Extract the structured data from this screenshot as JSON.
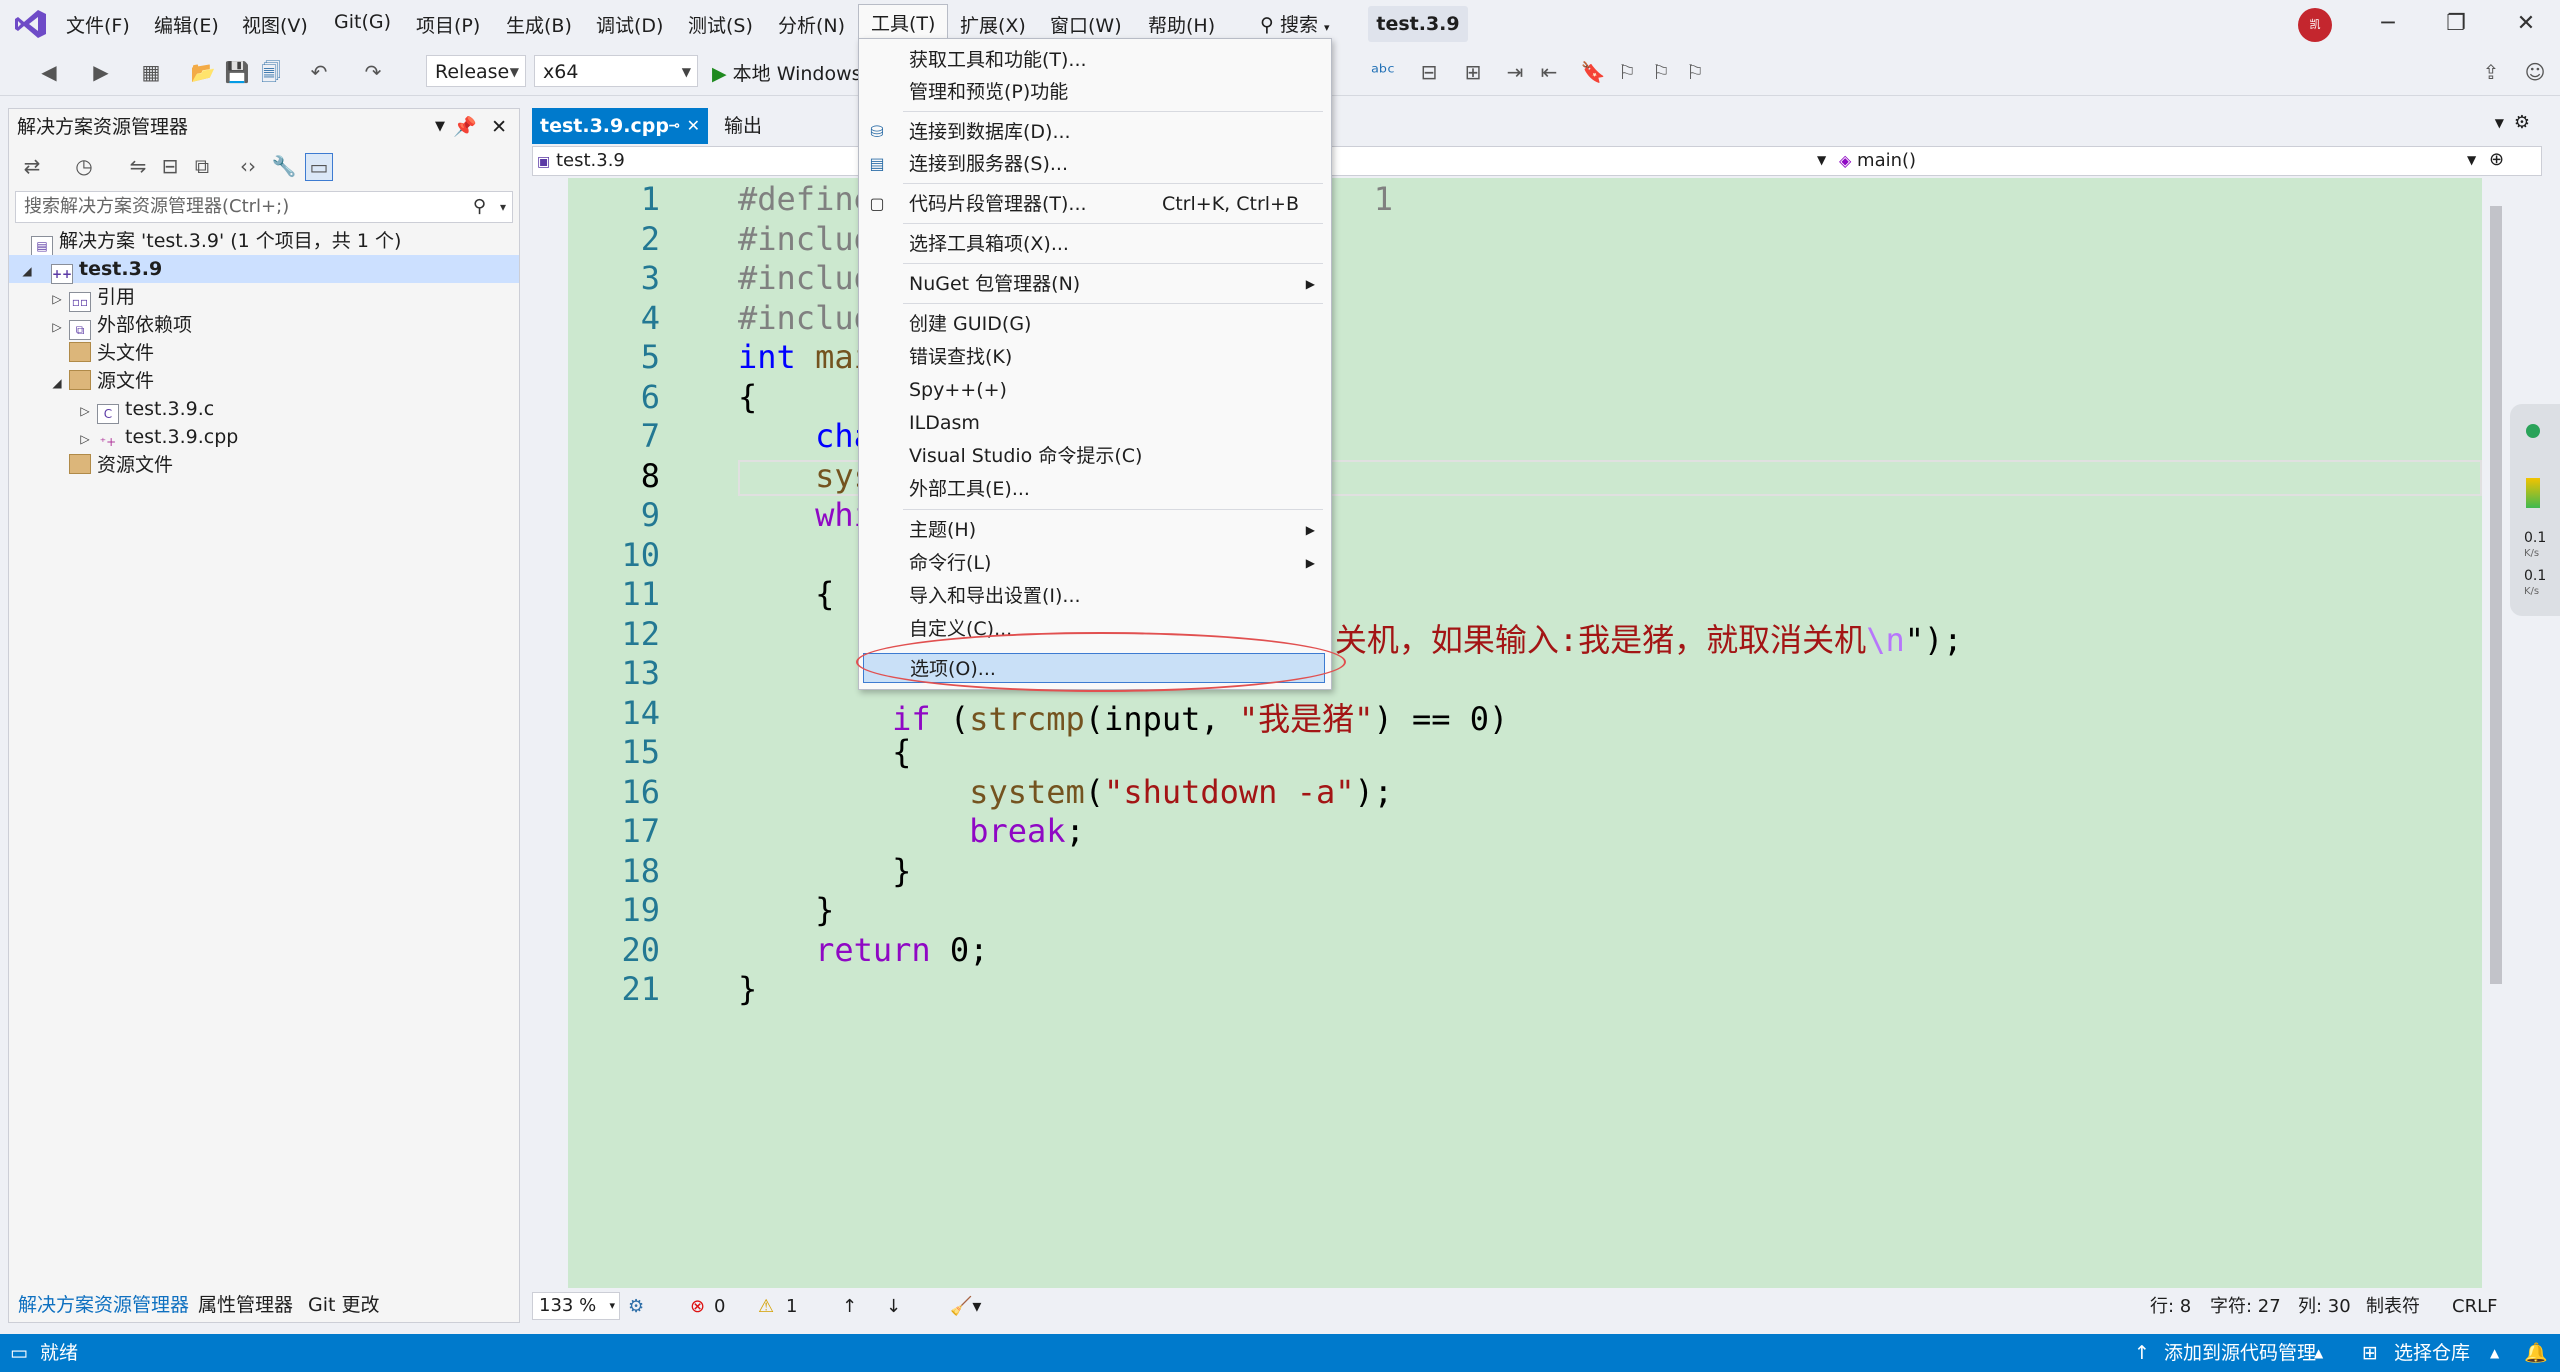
{
  "menubar": {
    "items": [
      "文件(F)",
      "编辑(E)",
      "视图(V)",
      "Git(G)",
      "项目(P)",
      "生成(B)",
      "调试(D)",
      "测试(S)",
      "分析(N)",
      "工具(T)",
      "扩展(X)",
      "窗口(W)",
      "帮助(H)"
    ],
    "search_label": "搜索",
    "title": "test.3.9",
    "avatar_text": "凯"
  },
  "toolbar": {
    "config": "Release",
    "platform": "x64",
    "run_label": "本地 Windows"
  },
  "solution_explorer": {
    "title": "解决方案资源管理器",
    "search_placeholder": "搜索解决方案资源管理器(Ctrl+;)",
    "tree": [
      {
        "label": "解决方案 'test.3.9' (1 个项目，共 1 个)",
        "indent": 0
      },
      {
        "label": "test.3.9",
        "indent": 1,
        "selected": true
      },
      {
        "label": "引用",
        "indent": 2
      },
      {
        "label": "外部依赖项",
        "indent": 2
      },
      {
        "label": "头文件",
        "indent": 2
      },
      {
        "label": "源文件",
        "indent": 2
      },
      {
        "label": "test.3.9.c",
        "indent": 3
      },
      {
        "label": "test.3.9.cpp",
        "indent": 3
      },
      {
        "label": "资源文件",
        "indent": 2
      }
    ],
    "bottom_tabs": [
      "解决方案资源管理器",
      "属性管理器",
      "Git 更改"
    ]
  },
  "editor": {
    "active_tab": "test.3.9.cpp",
    "other_tab": "输出",
    "nav_project": "test.3.9",
    "nav_function": "main()",
    "line_numbers": [
      "1",
      "2",
      "3",
      "4",
      "5",
      "6",
      "7",
      "8",
      "9",
      "10",
      "11",
      "12",
      "13",
      "14",
      "15",
      "16",
      "17",
      "18",
      "19",
      "20",
      "21"
    ]
  },
  "tools_menu": {
    "items": [
      {
        "label": "获取工具和功能(T)..."
      },
      {
        "label": "管理和预览(P)功能"
      },
      {
        "label": "连接到数据库(D)...",
        "icon": "database-icon"
      },
      {
        "label": "连接到服务器(S)...",
        "icon": "server-icon"
      },
      {
        "label": "代码片段管理器(T)...",
        "shortcut": "Ctrl+K, Ctrl+B",
        "icon": "snippet-icon"
      },
      {
        "label": "选择工具箱项(X)..."
      },
      {
        "label": "NuGet 包管理器(N)",
        "submenu": true
      },
      {
        "label": "创建 GUID(G)"
      },
      {
        "label": "错误查找(K)"
      },
      {
        "label": "Spy++(+)"
      },
      {
        "label": "ILDasm"
      },
      {
        "label": "Visual Studio 命令提示(C)"
      },
      {
        "label": "外部工具(E)..."
      },
      {
        "label": "主题(H)",
        "submenu": true
      },
      {
        "label": "命令行(L)",
        "submenu": true
      },
      {
        "label": "导入和导出设置(I)..."
      },
      {
        "label": "自定义(C)..."
      },
      {
        "label": "选项(O)...",
        "highlighted": true
      }
    ]
  },
  "editor_status": {
    "zoom": "133 %",
    "errors": "0",
    "warnings": "1",
    "line": "行: 8",
    "char": "字符: 27",
    "col": "列: 30",
    "tabs": "制表符",
    "eol": "CRLF"
  },
  "statusbar": {
    "left": "就绪",
    "source_control": "添加到源代码管理",
    "repo": "选择仓库"
  },
  "net_widget": {
    "up": "0.1",
    "down": "0.1",
    "unit": "K/s"
  }
}
